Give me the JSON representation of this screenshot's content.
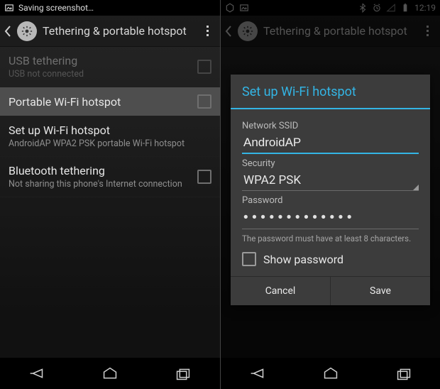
{
  "left": {
    "statusbar": {
      "saving": "Saving screenshot…"
    },
    "actionbar": {
      "title": "Tethering & portable hotspot"
    },
    "items": [
      {
        "title": "USB tethering",
        "sub": "USB not connected"
      },
      {
        "title": "Portable Wi-Fi hotspot",
        "sub": ""
      },
      {
        "title": "Set up Wi-Fi hotspot",
        "sub": "AndroidAP WPA2 PSK portable Wi-Fi hotspot"
      },
      {
        "title": "Bluetooth tethering",
        "sub": "Not sharing this phone's Internet connection"
      }
    ]
  },
  "right": {
    "statusbar": {
      "time": "12:19"
    },
    "actionbar": {
      "title": "Tethering & portable hotspot"
    },
    "dialog": {
      "title": "Set up Wi-Fi hotspot",
      "ssid_label": "Network SSID",
      "ssid_value": "AndroidAP",
      "security_label": "Security",
      "security_value": "WPA2 PSK",
      "password_label": "Password",
      "password_value": "•••••••••••••",
      "hint": "The password must have at least 8 characters.",
      "show_pw": "Show password",
      "cancel": "Cancel",
      "save": "Save"
    }
  }
}
